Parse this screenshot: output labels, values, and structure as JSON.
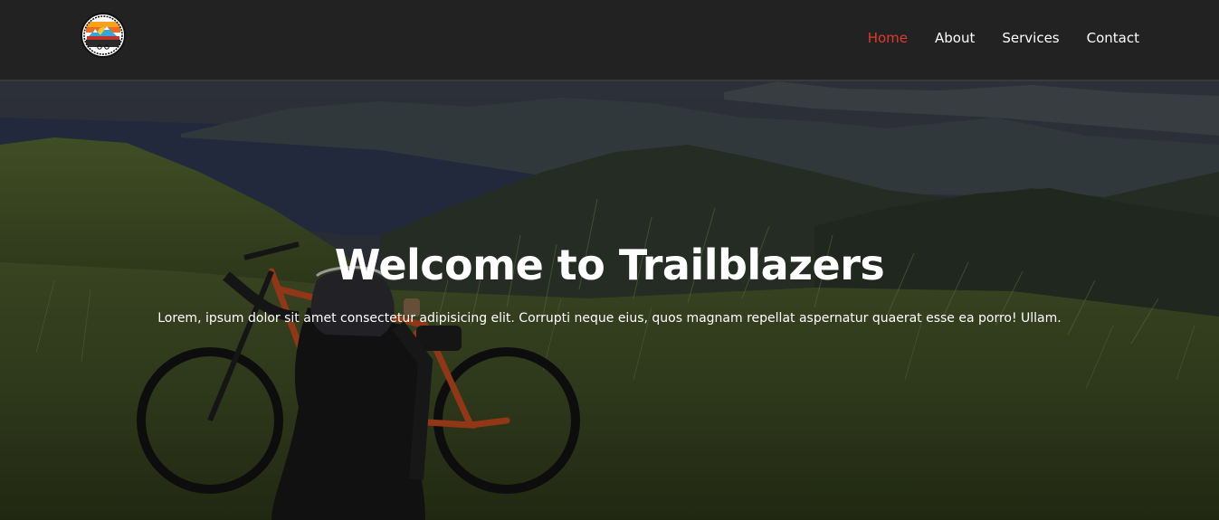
{
  "nav": {
    "logo_name": "trailblazers-logo",
    "links": [
      {
        "label": "Home",
        "active": true
      },
      {
        "label": "About",
        "active": false
      },
      {
        "label": "Services",
        "active": false
      },
      {
        "label": "Contact",
        "active": false
      }
    ]
  },
  "hero": {
    "title": "Welcome to Trailblazers",
    "subtitle": "Lorem, ipsum dolor sit amet consectetur adipisicing elit. Corrupti neque eius, quos magnam repellat aspernatur quaerat esse ea porro! Ullam."
  },
  "colors": {
    "navbar_bg": "#222222",
    "active_link": "#e03a2c",
    "text": "#ffffff"
  }
}
